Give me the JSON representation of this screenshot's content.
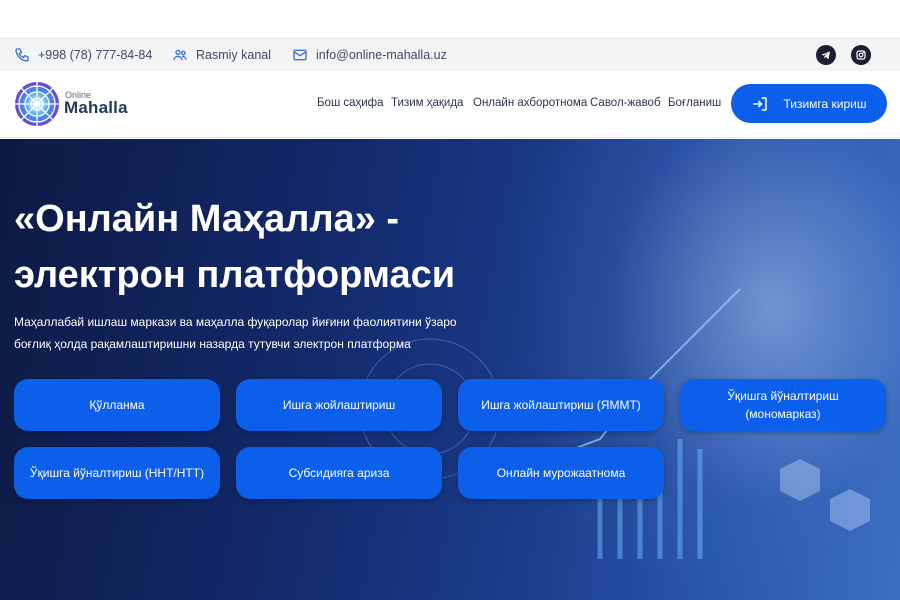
{
  "info_bar": {
    "phone": "+998 (78) 777-84-84",
    "channel": "Rasmiy kanal",
    "email": "info@online-mahalla.uz",
    "social": [
      "telegram-icon",
      "instagram-icon"
    ]
  },
  "header": {
    "logo_small": "Online",
    "logo_big": "Mahalla",
    "nav": [
      "Бош саҳифа",
      "Тизим ҳақида",
      "Онлайн ахборотнома",
      "Савол-жавоб",
      "Боғланиш"
    ],
    "login_label": "Тизимга кириш"
  },
  "hero": {
    "title_line1": "«Онлайн Маҳалла» -",
    "title_line2": "электрон платформаси",
    "subtitle": "Маҳаллабай ишлаш маркази ва маҳалла фуқаролар йиғини фаолиятини ўзаро боғлиқ ҳолда рақамлаштиришни назарда тутувчи электрон платформа",
    "buttons": [
      "Қўлланма",
      "Ишга жойлаштириш",
      "Ишга жойлаштириш (ЯММТ)",
      "Ўқишга йўналтириш (мономарказ)",
      "Ўқишга йўналтириш (ННТ/НТТ)",
      "Субсидияга ариза",
      "Онлайн мурожаатнома"
    ]
  },
  "colors": {
    "accent": "#0b5fea",
    "hero_dark": "#0c1a44",
    "text_dark": "#2a3550"
  }
}
